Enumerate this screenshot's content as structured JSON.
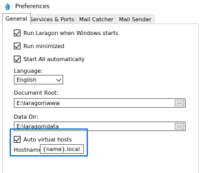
{
  "window": {
    "title": "Preferences",
    "icon": "laragon-app-icon"
  },
  "tabs": [
    {
      "label": "General",
      "active": true
    },
    {
      "label": "Services & Ports",
      "active": false
    },
    {
      "label": "Mail Catcher",
      "active": false
    },
    {
      "label": "Mail Sender",
      "active": false
    }
  ],
  "general": {
    "run_on_start": {
      "label": "Run Laragon when Windows starts",
      "checked": true
    },
    "run_minimized": {
      "label": "Run minimized",
      "checked": true
    },
    "start_all": {
      "label": "Start All automatically",
      "checked": true
    },
    "language": {
      "label": "Language:",
      "value": "English"
    },
    "document_root": {
      "label": "Document Root:",
      "value": "E:\\laragon\\www",
      "browse_label": "..."
    },
    "data_dir": {
      "label": "Data Dir:",
      "value": "E:\\laragon\\data",
      "browse_label": "..."
    },
    "auto_virtual_hosts": {
      "label": "Auto virtual hosts",
      "checked": true
    },
    "hostname": {
      "label": "Hostname:",
      "value": "{name}.local"
    }
  },
  "colors": {
    "highlight": "#2b79d8",
    "app_icon": "#1e88c8"
  }
}
